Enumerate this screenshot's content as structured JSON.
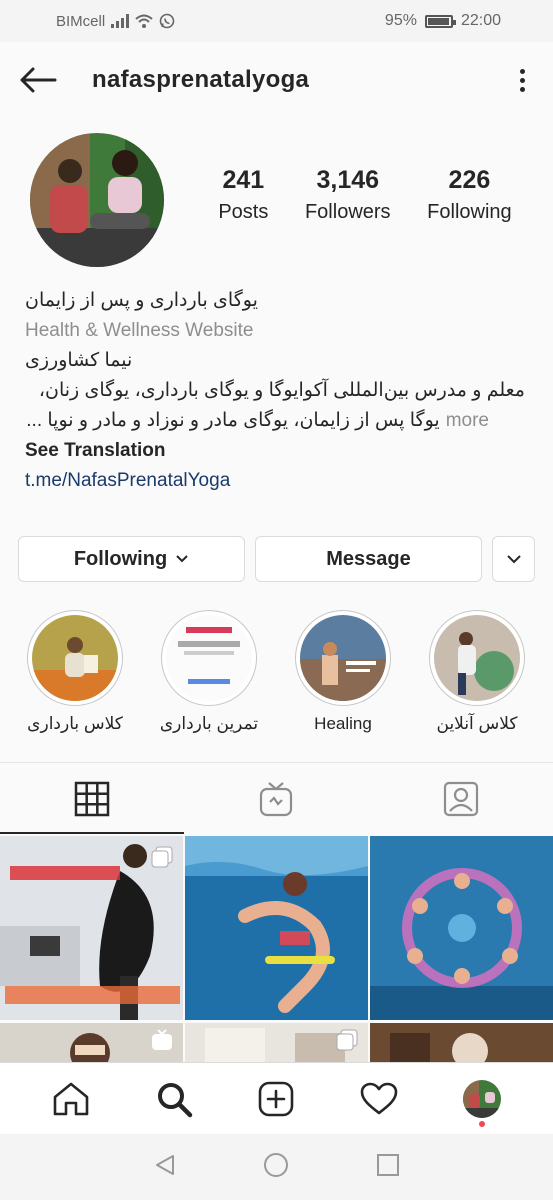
{
  "status_bar": {
    "carrier": "BIMcell",
    "battery": "95%",
    "time": "22:00"
  },
  "header": {
    "username": "nafasprenatalyoga"
  },
  "profile": {
    "stats": [
      {
        "value": "241",
        "label": "Posts"
      },
      {
        "value": "3,146",
        "label": "Followers"
      },
      {
        "value": "226",
        "label": "Following"
      }
    ]
  },
  "bio": {
    "name": "یوگای بارداری و پس از زایمان",
    "category": "Health & Wellness Website",
    "person": "نیما کشاورزی",
    "line1": "معلم و مدرس بین‌المللی آکوایوگا و یوگای بارداری، یوگای زنان،",
    "line2": "یوگا پس از زایمان، یوگای مادر و نوزاد و مادر و نوپا ...",
    "more": "more",
    "see_translation": "See Translation",
    "link": "t.me/NafasPrenatalYoga"
  },
  "actions": {
    "following": "Following",
    "message": "Message"
  },
  "highlights": [
    {
      "label": "کلاس بارداری"
    },
    {
      "label": "تمرین بارداری"
    },
    {
      "label": "Healing"
    },
    {
      "label": "کلاس آنلاین"
    }
  ],
  "colors": {
    "link": "#1a3a6b",
    "accent": "#ed4956",
    "border": "#dbdbdb"
  }
}
